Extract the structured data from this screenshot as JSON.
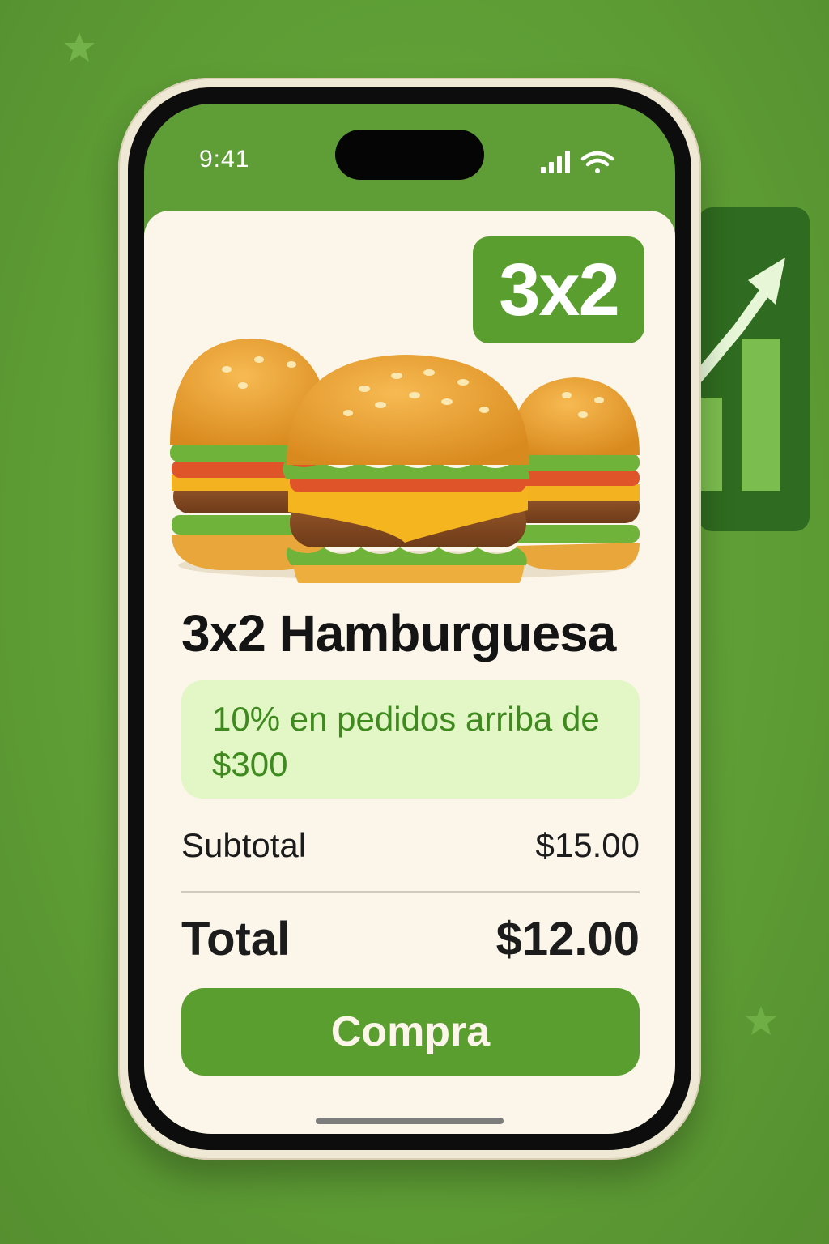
{
  "status_bar": {
    "time": "9:41"
  },
  "promo_badge": {
    "label": "3x2"
  },
  "product": {
    "title": "3x2 Hamburguesa"
  },
  "discount": {
    "text": "10% en pedidos arriba de $300"
  },
  "summary": {
    "subtotal_label": "Subtotal",
    "subtotal_value": "$15.00",
    "total_label": "Total",
    "total_value": "$12.00"
  },
  "actions": {
    "buy_label": "Compra"
  },
  "colors": {
    "brand_green": "#5b9e30",
    "card_background": "#fcf6ea",
    "discount_background": "#e2f6c6",
    "discount_text": "#3f8a1f"
  },
  "icons": [
    "signal-icon",
    "wifi-icon",
    "star-icon",
    "trend-chart-icon"
  ]
}
